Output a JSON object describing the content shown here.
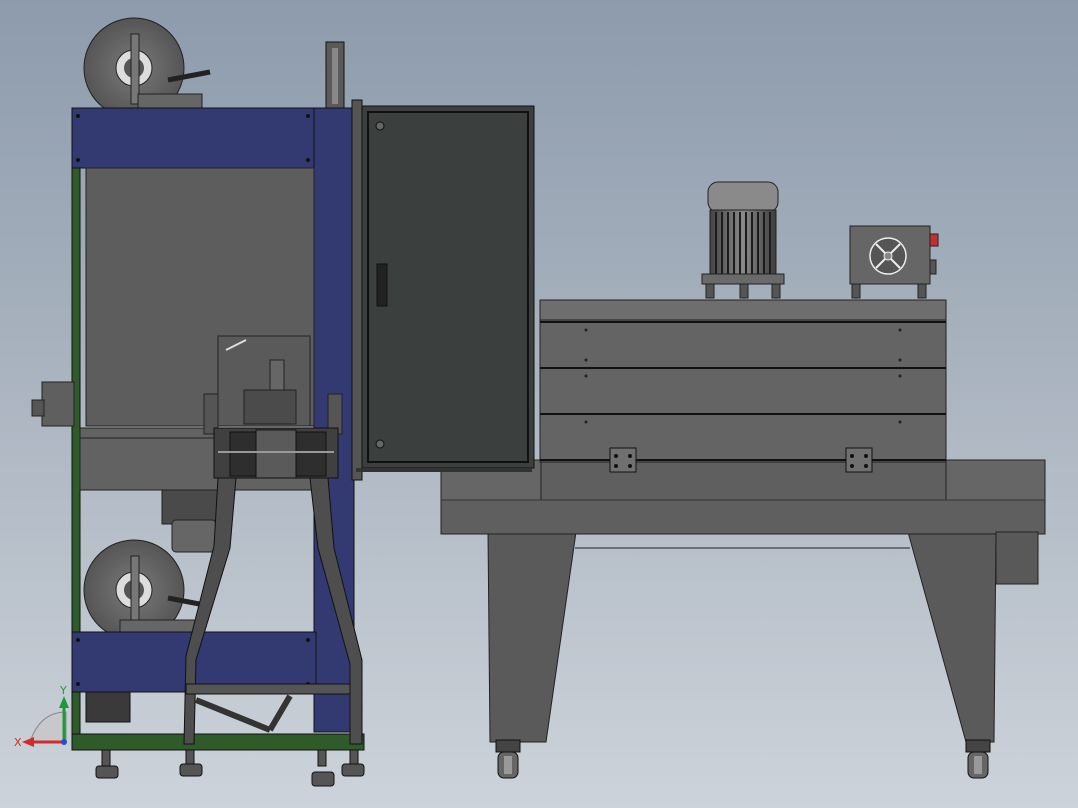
{
  "viewport": {
    "background_top": "#8d9bac",
    "background_bottom": "#cdd3da"
  },
  "colors": {
    "frame_blue": "#333a72",
    "frame_green": "#2f5a2a",
    "machine_gray": "#5c5c5c",
    "door_dark": "#3b3f3d",
    "panel_light": "#6a6a6a"
  },
  "triad": {
    "x_label": "X",
    "y_label": "Y",
    "x_color": "#d42a2a",
    "y_color": "#1f9a3a",
    "z_color": "#2a4ad4"
  }
}
